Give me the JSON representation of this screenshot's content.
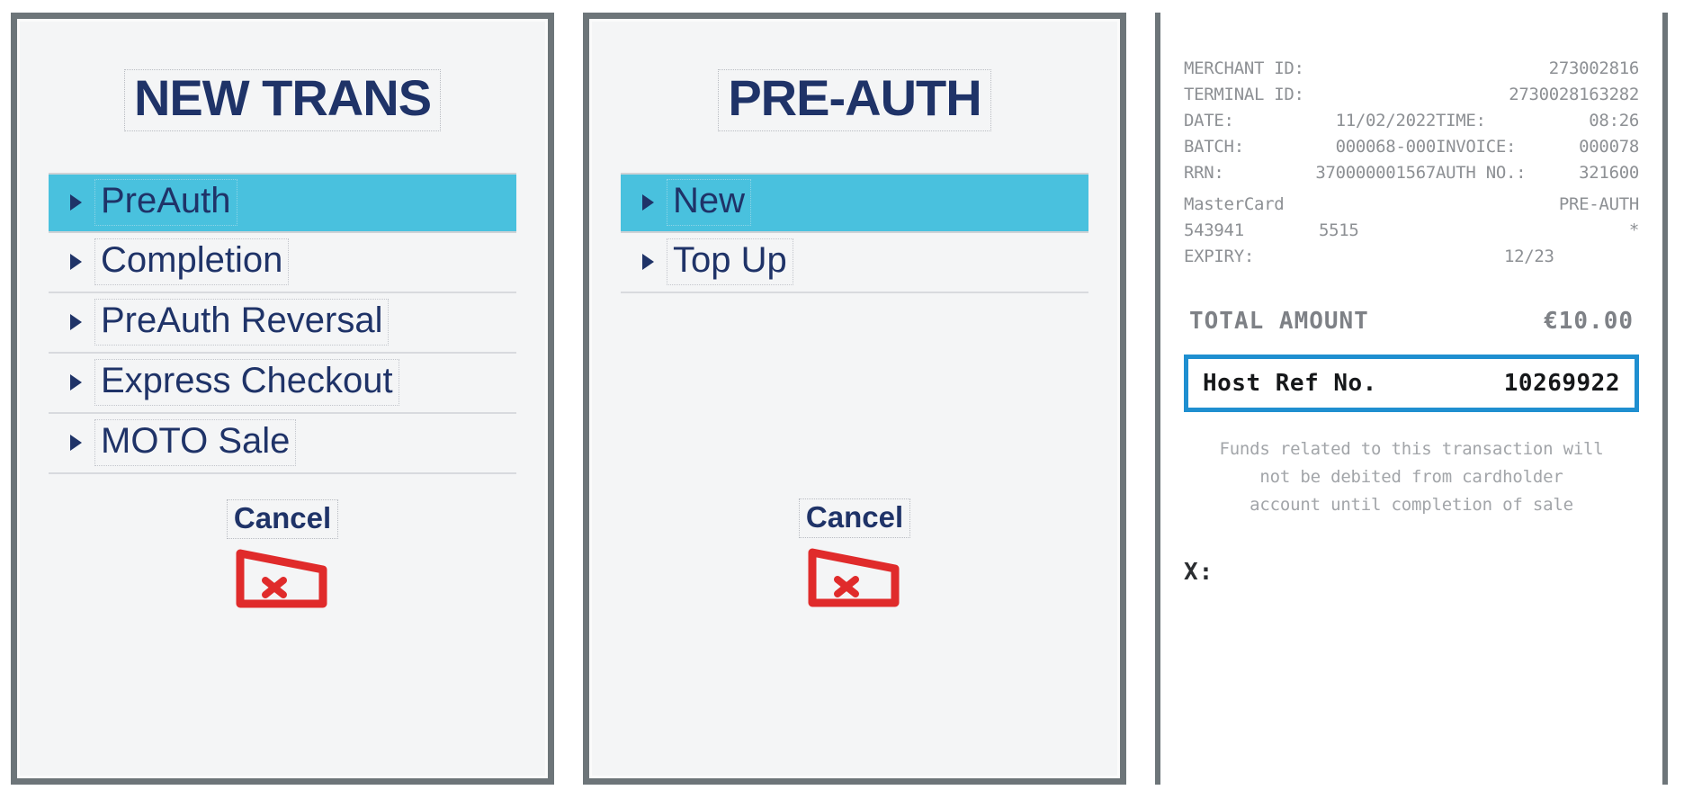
{
  "panels": [
    {
      "title": "NEW TRANS",
      "items": [
        {
          "label": "PreAuth",
          "selected": true
        },
        {
          "label": "Completion",
          "selected": false
        },
        {
          "label": "PreAuth Reversal",
          "selected": false
        },
        {
          "label": "Express Checkout",
          "selected": false
        },
        {
          "label": "MOTO Sale",
          "selected": false
        }
      ],
      "cancel_label": "Cancel"
    },
    {
      "title": "PRE-AUTH",
      "items": [
        {
          "label": "New",
          "selected": true
        },
        {
          "label": "Top Up",
          "selected": false
        }
      ],
      "cancel_label": "Cancel"
    }
  ],
  "receipt": {
    "rows": [
      {
        "key": "MERCHANT ID:",
        "value": "273002816",
        "key2": "",
        "value2": ""
      },
      {
        "key": "TERMINAL ID:",
        "value": "2730028163282",
        "key2": "",
        "value2": ""
      },
      {
        "key": "DATE:",
        "value": "11/02/2022",
        "key2": "TIME:",
        "value2": "08:26"
      },
      {
        "key": "BATCH:",
        "value": "000068-000",
        "key2": "INVOICE:",
        "value2": "000078"
      },
      {
        "key": "RRN:",
        "value": "370000001567",
        "key2": "AUTH NO.:",
        "value2": "321600"
      }
    ],
    "card_scheme": "MasterCard",
    "transaction_type": "PRE-AUTH",
    "pan_left": "543941",
    "pan_right": "5515",
    "pan_marker": "*",
    "expiry_key": "EXPIRY:",
    "expiry_value": "12/23",
    "total_label": "TOTAL AMOUNT",
    "total_value": "€10.00",
    "host_ref_label": "Host Ref No.",
    "host_ref_value": "10269922",
    "host_ref_border_color": "#1f8fd0",
    "note_lines": [
      "Funds related to this transaction will",
      "not be debited from cardholder",
      "account until completion of sale"
    ],
    "signature_label": "X:"
  },
  "colors": {
    "highlight": "#49c1de",
    "navy_text": "#1f3368",
    "panel_bg": "#f4f5f6",
    "panel_border": "#6d7579",
    "cancel_red": "#e02b2b"
  }
}
